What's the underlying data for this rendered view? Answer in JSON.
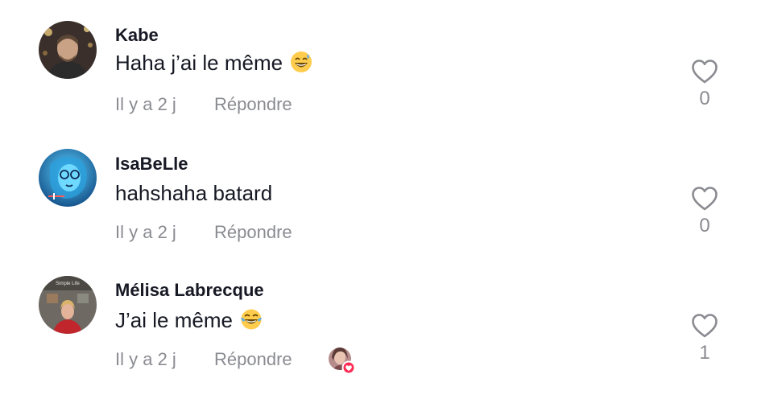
{
  "comments": [
    {
      "username": "Kabe",
      "text": "Haha j’ai le même",
      "emoji": "sweat-smile-emoji",
      "time": "Il y a 2 j",
      "reply_label": "Répondre",
      "like_count": "0",
      "liked_by_author": false
    },
    {
      "username": "IsaBeLle",
      "text": "hahshaha batard",
      "emoji": "",
      "time": "Il y a 2 j",
      "reply_label": "Répondre",
      "like_count": "0",
      "liked_by_author": false
    },
    {
      "username": "Mélisa Labrecque",
      "text": "J’ai le même",
      "emoji": "tears-of-joy-emoji",
      "time": "Il y a 2 j",
      "reply_label": "Répondre",
      "like_count": "1",
      "liked_by_author": true
    }
  ],
  "avatar_2_caption": "Simple Life",
  "colors": {
    "text": "#161823",
    "meta": "#8a8b91",
    "like_badge": "#fe2c55"
  },
  "icons": {
    "like": "heart-outline-icon",
    "liked_by_creator": "creator-heart-badge-icon"
  }
}
